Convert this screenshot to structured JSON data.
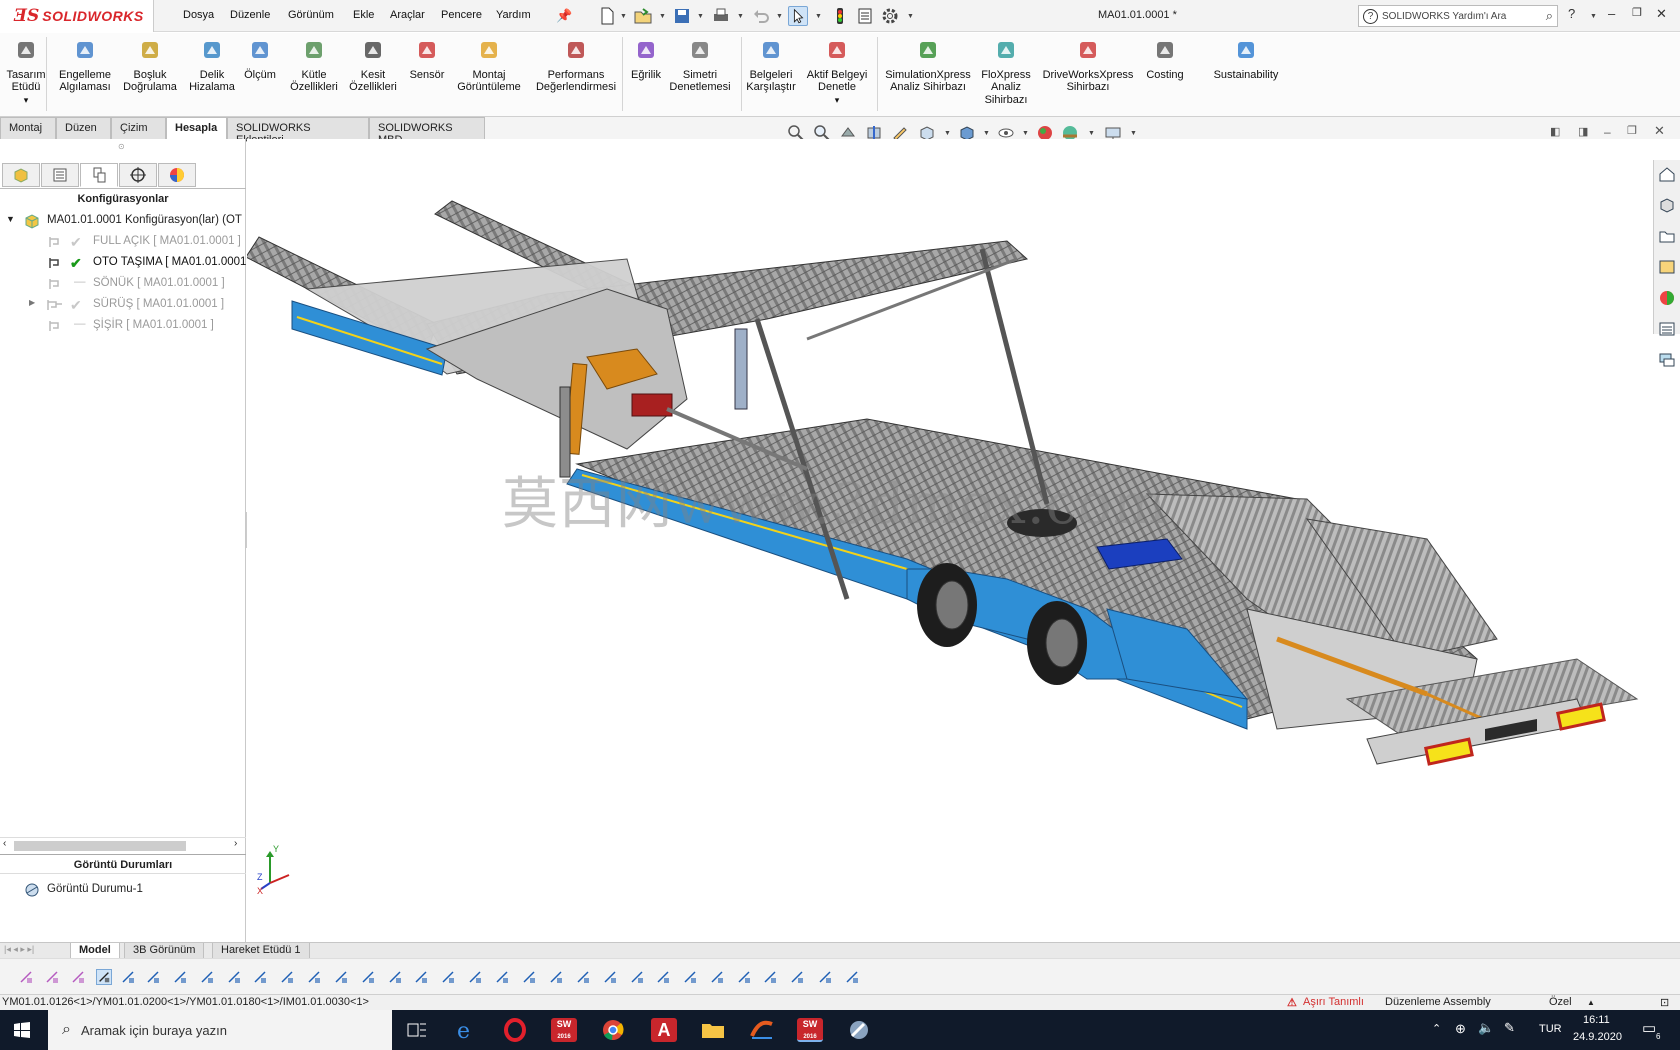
{
  "app": {
    "logo_ds": "ƎS",
    "logo_name": "SOLIDWORKS",
    "document_title": "MA01.01.0001 *",
    "help_search_placeholder": "SOLIDWORKS Yardım'ı Ara"
  },
  "menu": {
    "items": [
      "Dosya",
      "Düzenle",
      "Görünüm",
      "Ekle",
      "Araçlar",
      "Pencere",
      "Yardım"
    ]
  },
  "ribbon": {
    "buttons": [
      {
        "label": "Tasarım\nEtüdü",
        "icon": "design-study-icon"
      },
      {
        "label": "Engelleme\nAlgılaması",
        "icon": "interference-icon"
      },
      {
        "label": "Boşluk\nDoğrulama",
        "icon": "clearance-icon"
      },
      {
        "label": "Delik\nHizalama",
        "icon": "hole-alignment-icon"
      },
      {
        "label": "Ölçüm",
        "icon": "measure-icon"
      },
      {
        "label": "Kütle\nÖzellikleri",
        "icon": "mass-properties-icon"
      },
      {
        "label": "Kesit\nÖzellikleri",
        "icon": "section-properties-icon"
      },
      {
        "label": "Sensör",
        "icon": "sensor-icon"
      },
      {
        "label": "Montaj\nGörüntüleme",
        "icon": "assembly-visualization-icon"
      },
      {
        "label": "Performans\nDeğerlendirmesi",
        "icon": "performance-icon"
      },
      {
        "label": "Eğrilik",
        "icon": "curvature-icon"
      },
      {
        "label": "Simetri\nDenetlemesi",
        "icon": "symmetry-icon"
      },
      {
        "label": "Belgeleri\nKarşılaştır",
        "icon": "compare-icon"
      },
      {
        "label": "Aktif Belgeyi\nDenetle",
        "icon": "check-active-icon"
      },
      {
        "label": "SimulationXpress\nAnaliz Sihirbazı",
        "icon": "simulation-icon"
      },
      {
        "label": "FloXpress\nAnaliz\nSihirbazı",
        "icon": "floxpress-icon"
      },
      {
        "label": "DriveWorksXpress\nSihirbazı",
        "icon": "driveworks-icon"
      },
      {
        "label": "Costing",
        "icon": "costing-icon"
      },
      {
        "label": "Sustainability",
        "icon": "sustainability-icon"
      }
    ]
  },
  "tabs": [
    "Montaj",
    "Düzen",
    "Çizim",
    "Hesapla",
    "SOLIDWORKS Eklentileri",
    "SOLIDWORKS MBD"
  ],
  "active_tab": "Hesapla",
  "config_tree": {
    "heading": "Konfigürasyonlar",
    "root": "MA01.01.0001 Konfigürasyon(lar)  (OT",
    "items": [
      {
        "label": "FULL AÇIK [ MA01.01.0001 ]",
        "active": false
      },
      {
        "label": "OTO TAŞIMA [ MA01.01.0001",
        "active": true
      },
      {
        "label": "SÖNÜK [ MA01.01.0001 ]",
        "active": false
      },
      {
        "label": "SÜRÜŞ [ MA01.01.0001 ]",
        "active": false
      },
      {
        "label": "ŞİŞİR [ MA01.01.0001 ]",
        "active": false
      }
    ]
  },
  "display_states": {
    "heading": "Görüntü Durumları",
    "items": [
      "Görüntü Durumu-1"
    ]
  },
  "viewport": {
    "watermark": "莫西网www.3dmox.com",
    "triad": {
      "x": "X",
      "y": "Y",
      "z": "Z"
    }
  },
  "bottom_tabs": [
    "Model",
    "3B Görünüm",
    "Hareket Etüdü 1"
  ],
  "active_bottom_tab": "Model",
  "status": {
    "path": "YM01.01.0126<1>/YM01.01.0200<1>/YM01.01.0180<1>/IM01.01.0030<1>",
    "warning": "Aşırı Tanımlı",
    "mode": "Düzenleme Assembly",
    "units": "Özel"
  },
  "taskbar": {
    "search_placeholder": "Aramak için buraya yazın",
    "lang": "TUR",
    "time": "16:11",
    "date": "24.9.2020",
    "notifications": "6",
    "sw_badge": "2016"
  },
  "colors": {
    "brand_red": "#d9262b",
    "accent_blue": "#3b8bd6",
    "trailer_blue": "#2f8fd6",
    "taskbar": "#101a2a",
    "warning": "#d32f2f"
  }
}
